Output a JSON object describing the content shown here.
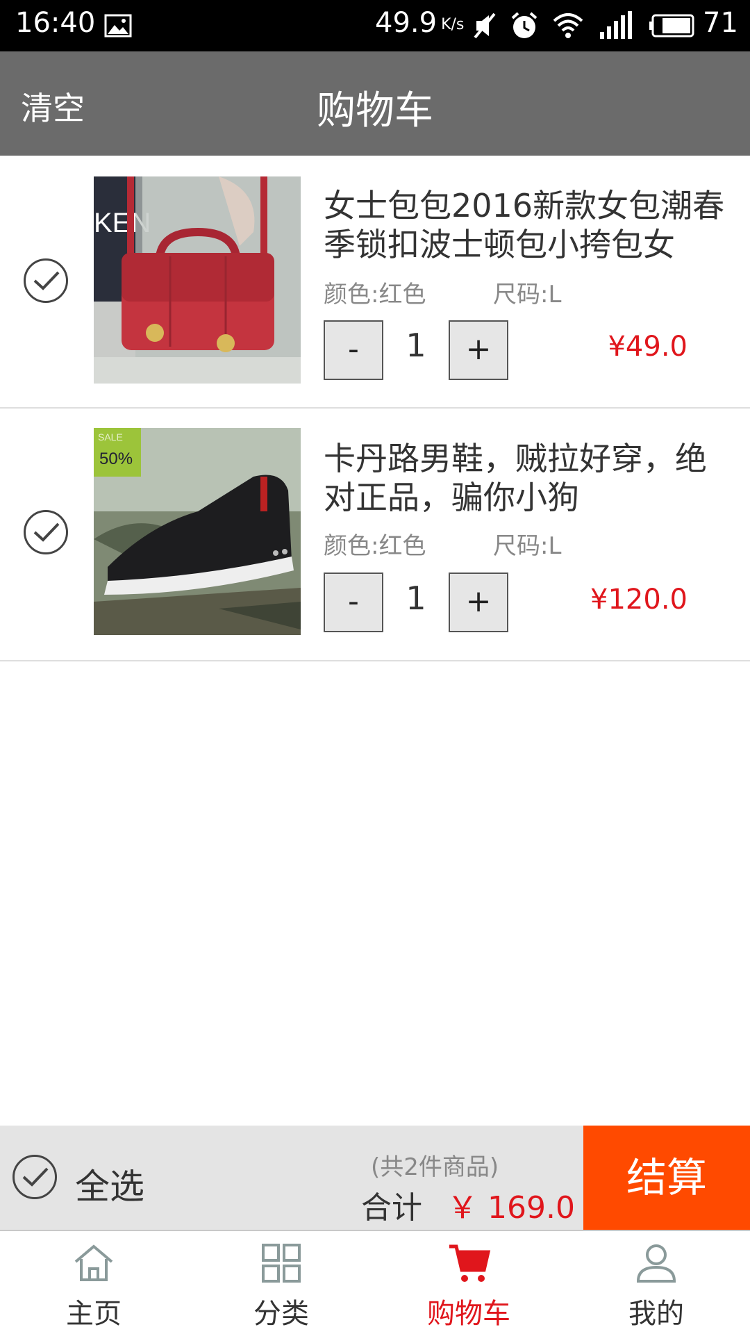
{
  "status_bar": {
    "time": "16:40",
    "speed": "49.9",
    "speed_unit": "K/s",
    "battery": "71"
  },
  "header": {
    "clear_label": "清空",
    "title": "购物车"
  },
  "items": [
    {
      "name": "女士包包2016新款女包潮春季锁扣波士顿包小挎包女",
      "color": "颜色:红色",
      "size": "尺码:L",
      "minus": "-",
      "quantity": "1",
      "plus": "+",
      "price": "¥49.0",
      "image_icon": "red-handbag-photo"
    },
    {
      "name": "卡丹路男鞋，贼拉好穿，绝对正品，骗你小狗",
      "color": "颜色:红色",
      "size": "尺码:L",
      "minus": "-",
      "quantity": "1",
      "plus": "+",
      "price": "¥120.0",
      "image_icon": "black-shoe-photo",
      "badge_sale": "SALE",
      "badge_percent": "50%"
    }
  ],
  "summary": {
    "select_all": "全选",
    "count": "(共2件商品)",
    "total_label": "合计",
    "total_value": "￥ 169.0",
    "checkout": "结算"
  },
  "tabs": [
    {
      "label": "主页",
      "icon": "home-icon"
    },
    {
      "label": "分类",
      "icon": "category-icon"
    },
    {
      "label": "购物车",
      "icon": "cart-icon",
      "active": true
    },
    {
      "label": "我的",
      "icon": "profile-icon"
    }
  ],
  "colors": {
    "accent_red": "#e0161c",
    "checkout_orange": "#ff4a00",
    "header_gray": "#6b6b6b"
  }
}
